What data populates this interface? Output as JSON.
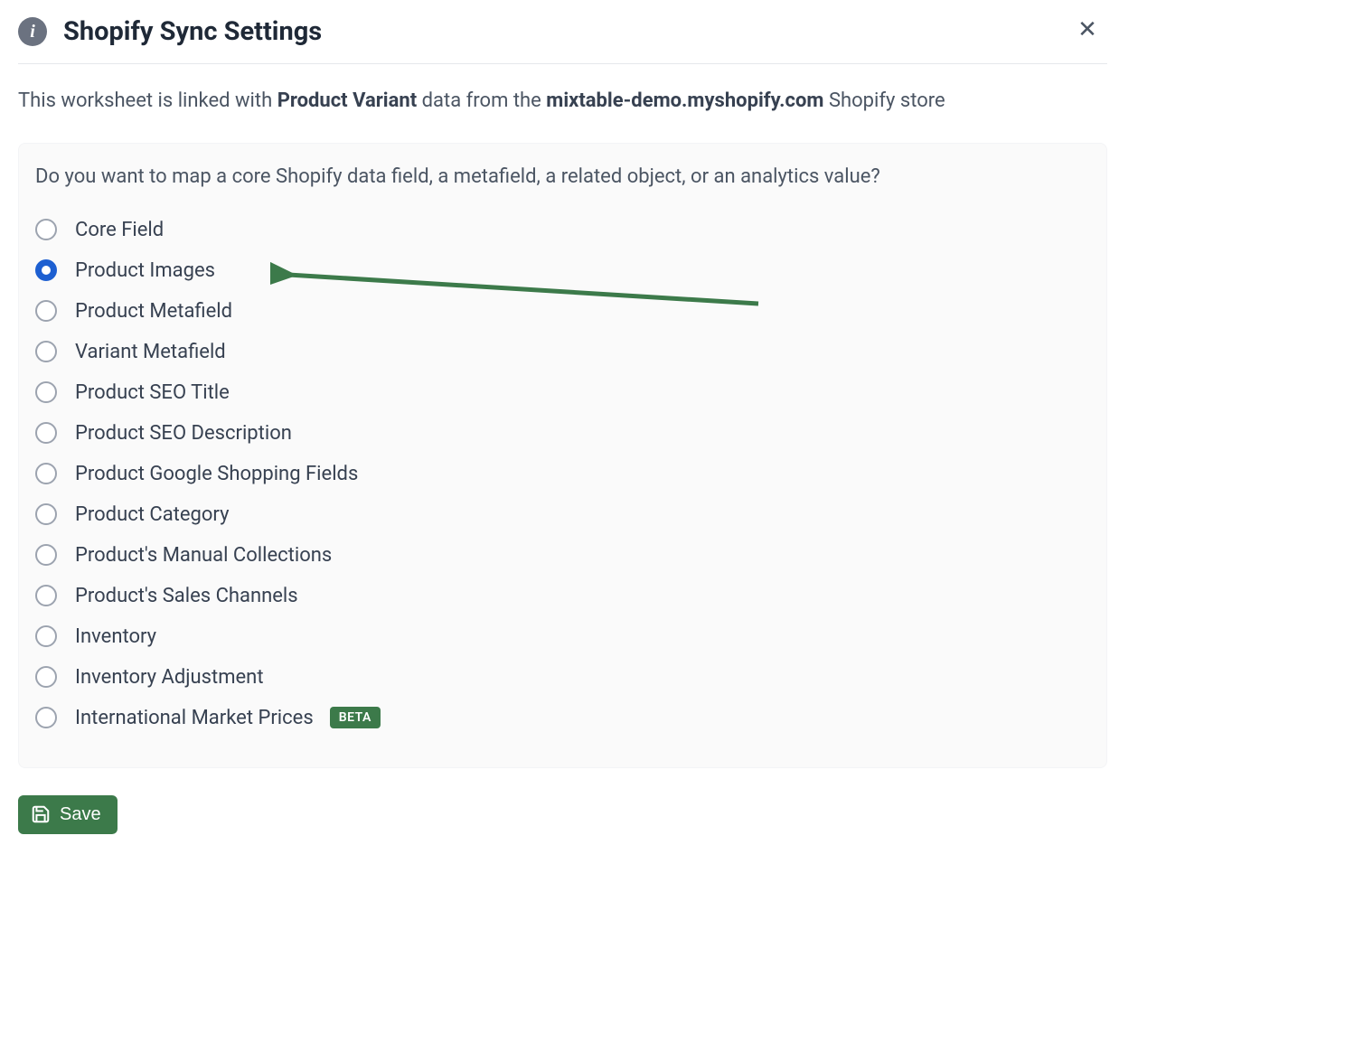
{
  "header": {
    "title": "Shopify Sync Settings"
  },
  "description": {
    "prefix": "This worksheet is linked with ",
    "data_type": "Product Variant",
    "middle": " data from the ",
    "store": "mixtable-demo.myshopify.com",
    "suffix": " Shopify store"
  },
  "panel": {
    "question": "Do you want to map a core Shopify data field, a metafield, a related object, or an analytics value?",
    "options": [
      {
        "label": "Core Field",
        "selected": false
      },
      {
        "label": "Product Images",
        "selected": true
      },
      {
        "label": "Product Metafield",
        "selected": false
      },
      {
        "label": "Variant Metafield",
        "selected": false
      },
      {
        "label": "Product SEO Title",
        "selected": false
      },
      {
        "label": "Product SEO Description",
        "selected": false
      },
      {
        "label": "Product Google Shopping Fields",
        "selected": false
      },
      {
        "label": "Product Category",
        "selected": false
      },
      {
        "label": "Product's Manual Collections",
        "selected": false
      },
      {
        "label": "Product's Sales Channels",
        "selected": false
      },
      {
        "label": "Inventory",
        "selected": false
      },
      {
        "label": "Inventory Adjustment",
        "selected": false
      },
      {
        "label": "International Market Prices",
        "selected": false,
        "badge": "BETA"
      }
    ]
  },
  "buttons": {
    "save": "Save"
  },
  "colors": {
    "accent_green": "#3c7a4a",
    "radio_selected": "#1d5fd1"
  }
}
